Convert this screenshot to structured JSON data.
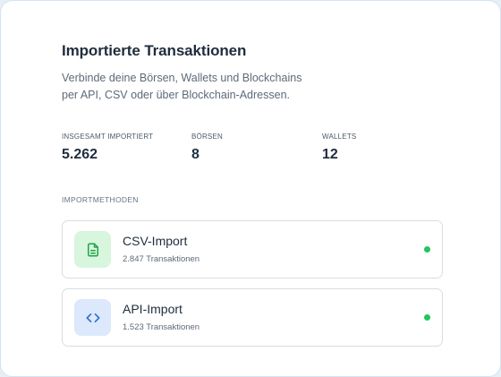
{
  "header": {
    "title": "Importierte Transaktionen",
    "subtitle_line1": "Verbinde deine Börsen, Wallets und Blockchains",
    "subtitle_line2": "per API, CSV oder über Blockchain-Adressen."
  },
  "stats": [
    {
      "label": "INSGESAMT IMPORTIERT",
      "value": "5.262"
    },
    {
      "label": "BÖRSEN",
      "value": "8"
    },
    {
      "label": "WALLETS",
      "value": "12"
    }
  ],
  "section_label": "IMPORTMETHODEN",
  "methods": [
    {
      "title": "CSV-Import",
      "subtitle": "2.847 Transaktionen",
      "icon": "file-document-icon",
      "icon_color": "#22a24a",
      "icon_bg": "#d8f5dd",
      "status_color": "#22c55e"
    },
    {
      "title": "API-Import",
      "subtitle": "1.523 Transaktionen",
      "icon": "code-brackets-icon",
      "icon_color": "#2f6fd6",
      "icon_bg": "#dce8fb",
      "status_color": "#22c55e"
    }
  ]
}
